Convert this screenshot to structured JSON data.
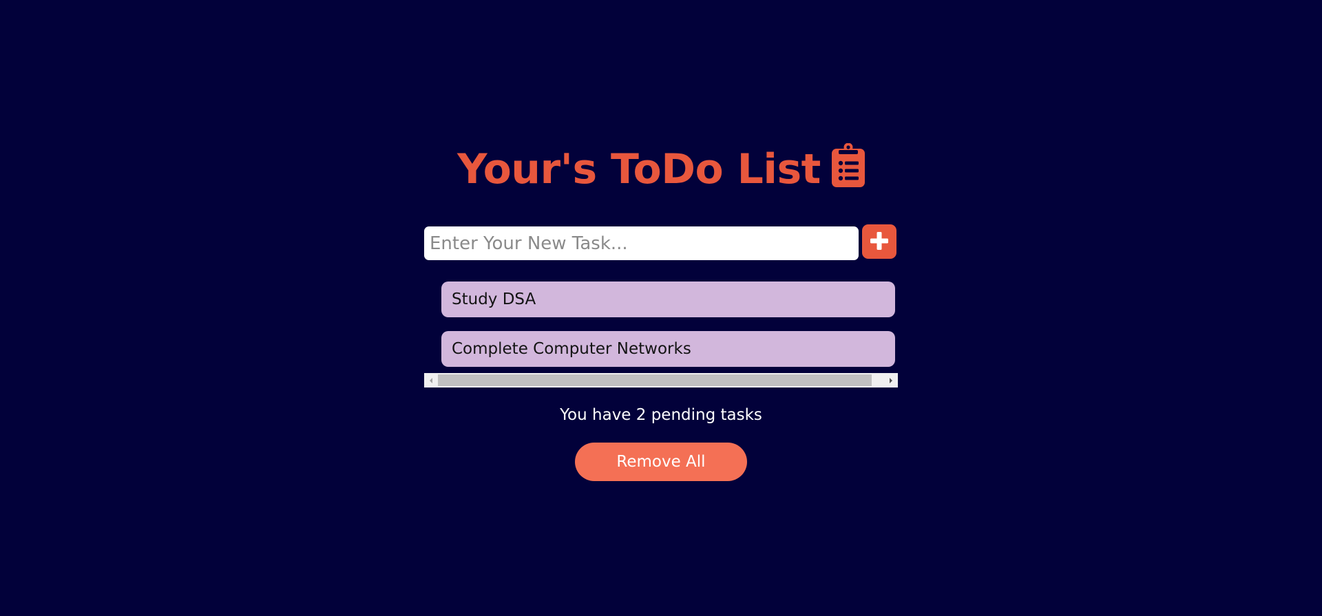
{
  "header": {
    "title": "Your's ToDo List",
    "icon": "clipboard-list-icon"
  },
  "input": {
    "placeholder": "Enter Your New Task...",
    "value": ""
  },
  "add_button": {
    "icon": "plus-icon"
  },
  "tasks": [
    {
      "label": "Study DSA"
    },
    {
      "label": "Complete Computer Networks"
    }
  ],
  "footer": {
    "pending_text": "You have 2 pending tasks",
    "remove_all_label": "Remove All"
  },
  "colors": {
    "background": "#02013a",
    "accent": "#e8573d",
    "task_bg": "#d2b7dc",
    "remove_button": "#f47055"
  }
}
